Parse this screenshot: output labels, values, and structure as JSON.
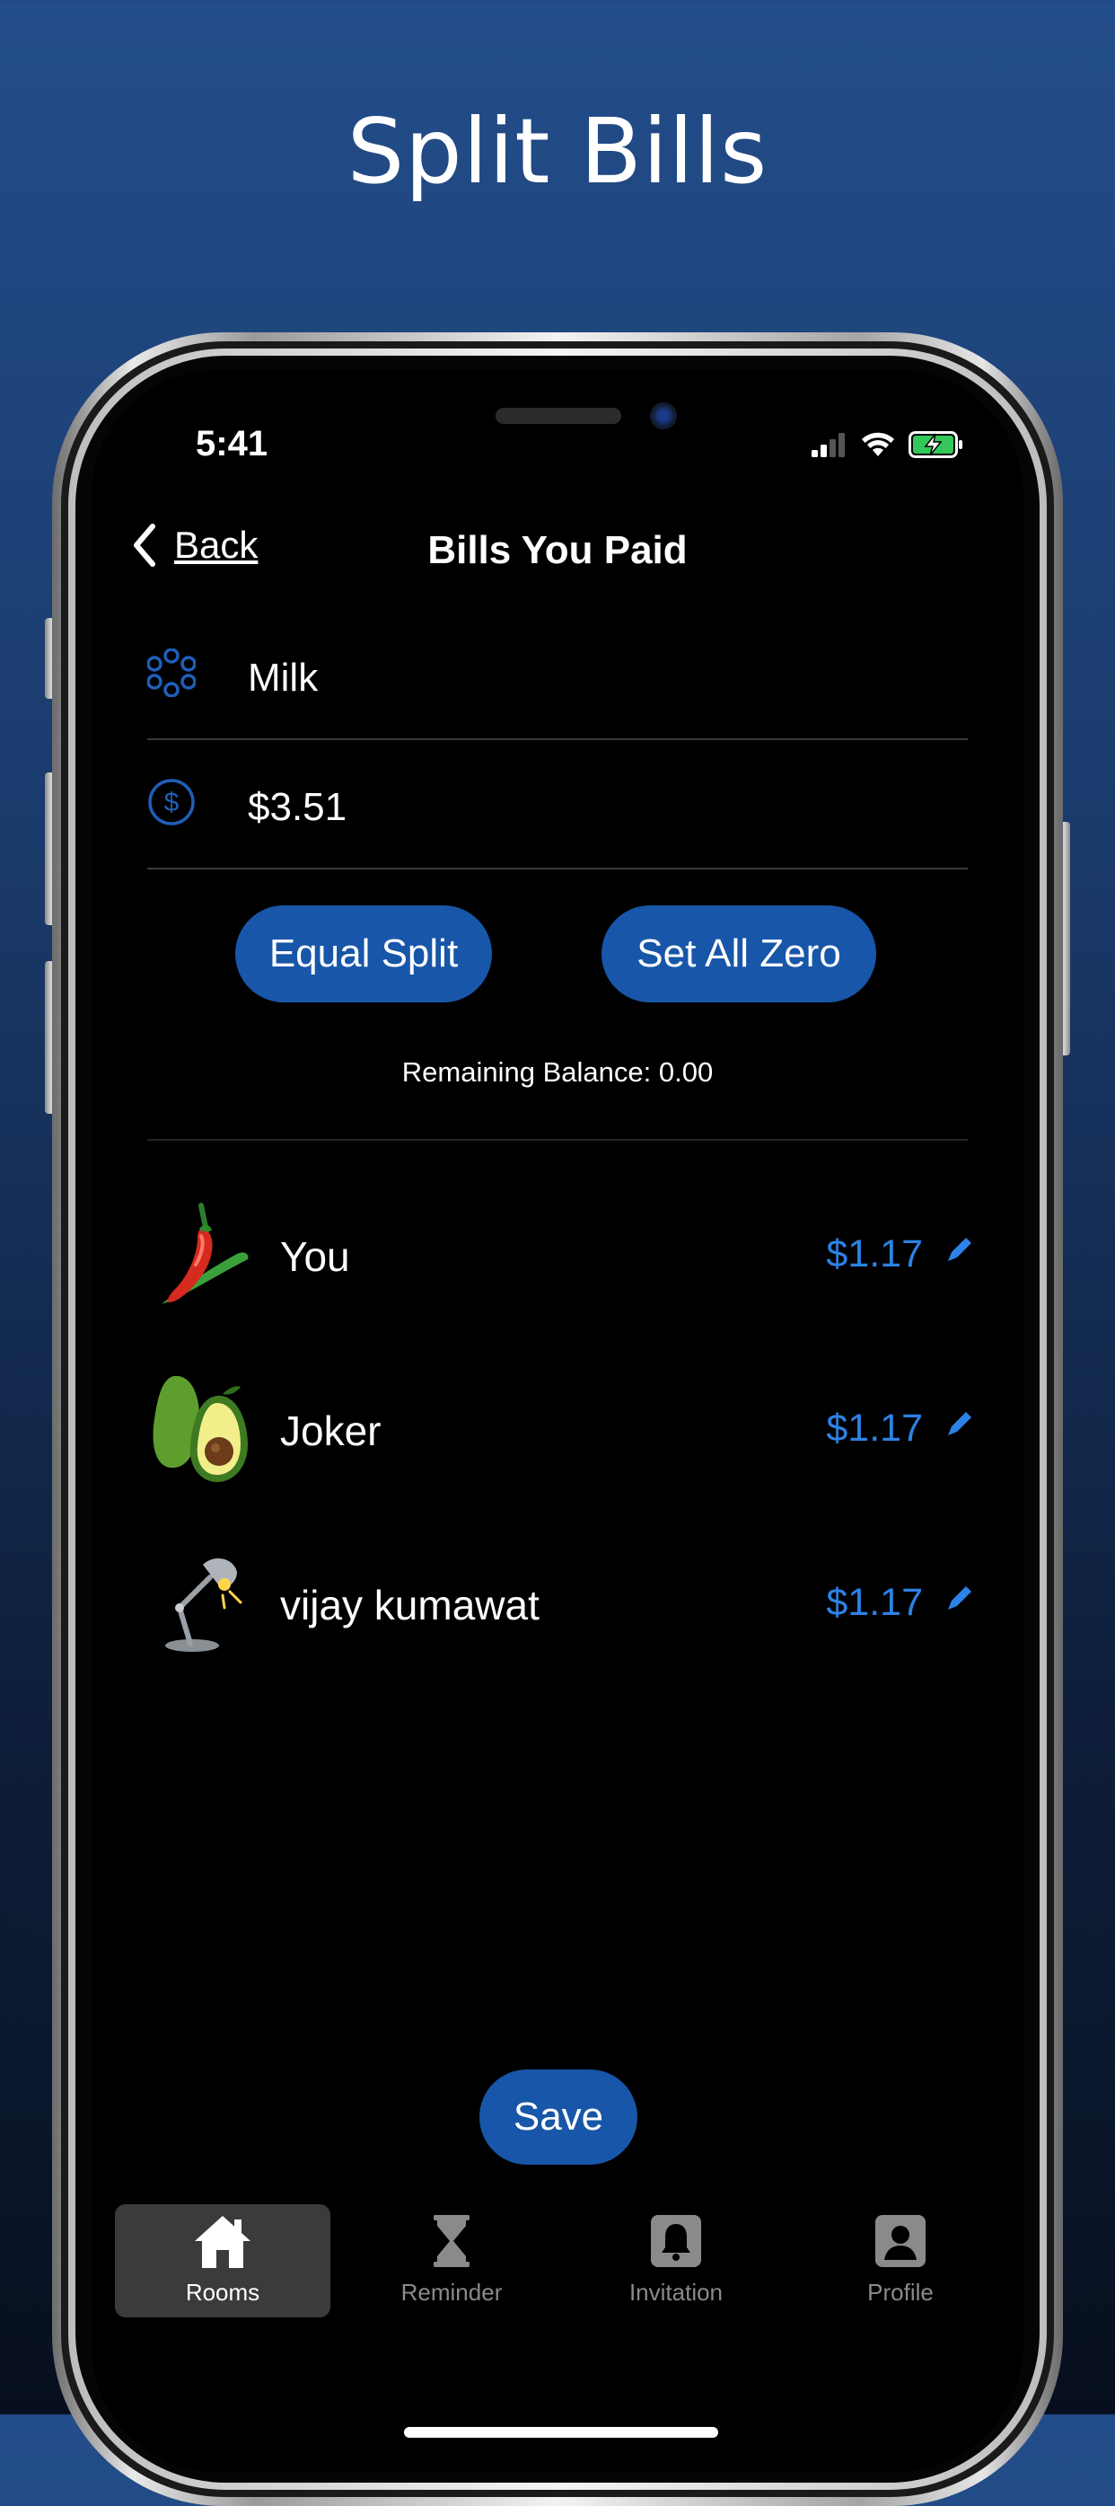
{
  "headline": "Split Bills",
  "status_bar": {
    "time": "5:41"
  },
  "nav": {
    "back_label": "Back",
    "title": "Bills You Paid"
  },
  "form": {
    "item_name": "Milk",
    "amount": "$3.51"
  },
  "actions": {
    "equal_split": "Equal Split",
    "set_all_zero": "Set All Zero"
  },
  "remaining_balance": "Remaining Balance: 0.00",
  "members": [
    {
      "name": "You",
      "amount": "$1.17",
      "avatar": "chili-pepper"
    },
    {
      "name": "Joker",
      "amount": "$1.17",
      "avatar": "avocado"
    },
    {
      "name": "vijay kumawat",
      "amount": "$1.17",
      "avatar": "desk-lamp"
    }
  ],
  "save_label": "Save",
  "tabbar": {
    "active": "Rooms",
    "tabs": [
      {
        "label": "Rooms",
        "icon": "home-icon"
      },
      {
        "label": "Reminder",
        "icon": "hourglass-icon"
      },
      {
        "label": "Invitation",
        "icon": "bell-icon"
      },
      {
        "label": "Profile",
        "icon": "profile-icon"
      }
    ]
  },
  "colors": {
    "accent": "#1756a8",
    "amount_text": "#2c82e6",
    "screen_bg": "#000000"
  }
}
